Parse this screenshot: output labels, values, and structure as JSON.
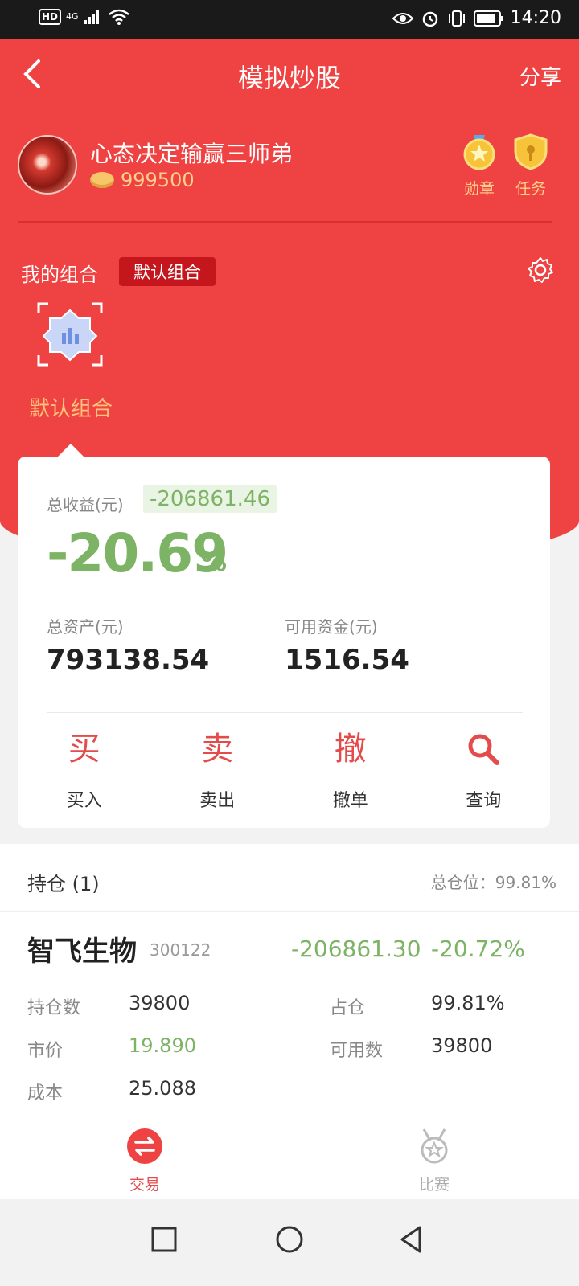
{
  "status_bar": {
    "hd": "HD",
    "network": "4G",
    "time": "14:20"
  },
  "header": {
    "title": "模拟炒股",
    "share_label": "分享"
  },
  "user": {
    "name": "心态决定输赢三师弟",
    "coins": "999500",
    "badges": [
      {
        "label": "勋章",
        "icon": "medal-icon"
      },
      {
        "label": "任务",
        "icon": "shield-task-icon"
      }
    ]
  },
  "portfolio": {
    "section_label": "我的组合",
    "tag": "默认组合",
    "selected_name": "默认组合"
  },
  "summary": {
    "total_profit_label": "总收益(元)",
    "total_profit_value": "-206861.46",
    "total_profit_pct": "-20.69",
    "pct_sign": "%",
    "total_assets_label": "总资产(元)",
    "total_assets_value": "793138.54",
    "available_funds_label": "可用资金(元)",
    "available_funds_value": "1516.54"
  },
  "actions": [
    {
      "glyph": "买",
      "label": "买入"
    },
    {
      "glyph": "卖",
      "label": "卖出"
    },
    {
      "glyph": "撤",
      "label": "撤单"
    },
    {
      "glyph": "search-icon",
      "label": "查询"
    }
  ],
  "holdings": {
    "title": "持仓 (1)",
    "position_ratio": "总仓位：99.81%",
    "stock": {
      "name": "智飞生物",
      "code": "300122",
      "profit_loss": "-206861.30",
      "profit_loss_pct": "-20.72%",
      "shares_label": "持仓数",
      "shares_value": "39800",
      "weight_label": "占仓",
      "weight_value": "99.81%",
      "price_label": "市价",
      "price_value": "19.890",
      "available_label": "可用数",
      "available_value": "39800",
      "cost_label": "成本",
      "cost_value": "25.088"
    }
  },
  "tabs": [
    {
      "label": "交易",
      "active": true
    },
    {
      "label": "比赛",
      "active": false
    }
  ],
  "colors": {
    "primary_red": "#ef4343",
    "loss_green": "#7db365",
    "coin_gold": "#ffd089"
  }
}
